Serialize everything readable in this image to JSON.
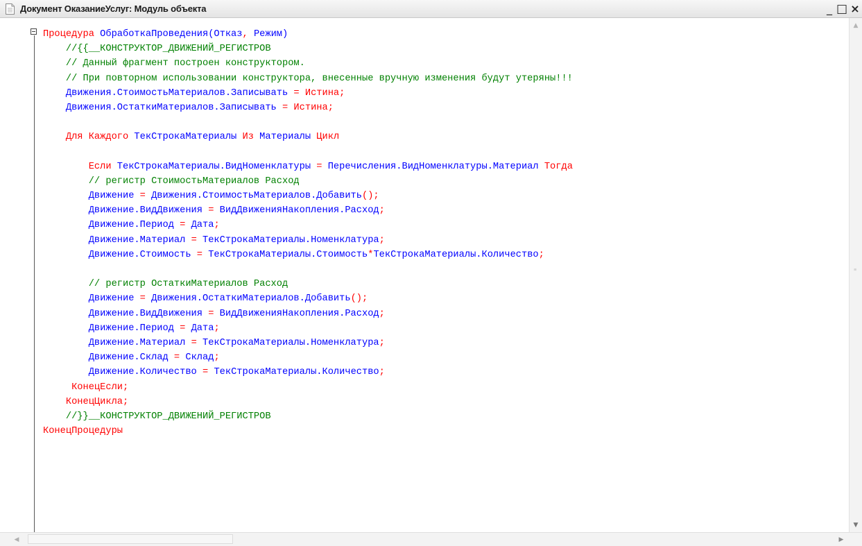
{
  "window": {
    "title": "Документ ОказаниеУслуг: Модуль объекта",
    "minimize_label": "_",
    "maximize_label": "□",
    "close_label": "×"
  },
  "colors": {
    "keyword": "#ff0000",
    "identifier": "#0000ff",
    "comment": "#008000"
  },
  "code": {
    "lines": [
      [
        [
          "kw",
          "Процедура "
        ],
        [
          "id",
          "ОбработкаПроведения(Отказ"
        ],
        [
          "op",
          ", "
        ],
        [
          "id",
          "Режим)"
        ]
      ],
      [
        [
          "cm",
          "    //{{__КОНСТРУКТОР_ДВИЖЕНИЙ_РЕГИСТРОВ"
        ]
      ],
      [
        [
          "cm",
          "    // Данный фрагмент построен конструктором."
        ]
      ],
      [
        [
          "cm",
          "    // При повторном использовании конструктора, внесенные вручную изменения будут утеряны!!!"
        ]
      ],
      [
        [
          "id",
          "    Движения.СтоимостьМатериалов.Записывать "
        ],
        [
          "op",
          "= "
        ],
        [
          "kw",
          "Истина"
        ],
        [
          "op",
          ";"
        ]
      ],
      [
        [
          "id",
          "    Движения.ОстаткиМатериалов.Записывать "
        ],
        [
          "op",
          "= "
        ],
        [
          "kw",
          "Истина"
        ],
        [
          "op",
          ";"
        ]
      ],
      [],
      [
        [
          "kw",
          "    Для Каждого "
        ],
        [
          "id",
          "ТекСтрокаМатериалы "
        ],
        [
          "kw",
          "Из "
        ],
        [
          "id",
          "Материалы "
        ],
        [
          "kw",
          "Цикл"
        ]
      ],
      [],
      [
        [
          "kw",
          "        Если "
        ],
        [
          "id",
          "ТекСтрокаМатериалы.ВидНоменклатуры "
        ],
        [
          "op",
          "= "
        ],
        [
          "id",
          "Перечисления.ВидНоменклатуры.Материал "
        ],
        [
          "kw",
          "Тогда"
        ]
      ],
      [
        [
          "cm",
          "        // регистр СтоимостьМатериалов Расход"
        ]
      ],
      [
        [
          "id",
          "        Движение "
        ],
        [
          "op",
          "= "
        ],
        [
          "id",
          "Движения.СтоимостьМатериалов.Добавить"
        ],
        [
          "op",
          "();"
        ]
      ],
      [
        [
          "id",
          "        Движение.ВидДвижения "
        ],
        [
          "op",
          "= "
        ],
        [
          "id",
          "ВидДвиженияНакопления.Расход"
        ],
        [
          "op",
          ";"
        ]
      ],
      [
        [
          "id",
          "        Движение.Период "
        ],
        [
          "op",
          "= "
        ],
        [
          "id",
          "Дата"
        ],
        [
          "op",
          ";"
        ]
      ],
      [
        [
          "id",
          "        Движение.Материал "
        ],
        [
          "op",
          "= "
        ],
        [
          "id",
          "ТекСтрокаМатериалы.Номенклатура"
        ],
        [
          "op",
          ";"
        ]
      ],
      [
        [
          "id",
          "        Движение.Стоимость "
        ],
        [
          "op",
          "= "
        ],
        [
          "id",
          "ТекСтрокаМатериалы.Стоимость"
        ],
        [
          "op",
          "*"
        ],
        [
          "id",
          "ТекСтрокаМатериалы.Количество"
        ],
        [
          "op",
          ";"
        ]
      ],
      [],
      [
        [
          "cm",
          "        // регистр ОстаткиМатериалов Расход"
        ]
      ],
      [
        [
          "id",
          "        Движение "
        ],
        [
          "op",
          "= "
        ],
        [
          "id",
          "Движения.ОстаткиМатериалов.Добавить"
        ],
        [
          "op",
          "();"
        ]
      ],
      [
        [
          "id",
          "        Движение.ВидДвижения "
        ],
        [
          "op",
          "= "
        ],
        [
          "id",
          "ВидДвиженияНакопления.Расход"
        ],
        [
          "op",
          ";"
        ]
      ],
      [
        [
          "id",
          "        Движение.Период "
        ],
        [
          "op",
          "= "
        ],
        [
          "id",
          "Дата"
        ],
        [
          "op",
          ";"
        ]
      ],
      [
        [
          "id",
          "        Движение.Материал "
        ],
        [
          "op",
          "= "
        ],
        [
          "id",
          "ТекСтрокаМатериалы.Номенклатура"
        ],
        [
          "op",
          ";"
        ]
      ],
      [
        [
          "id",
          "        Движение.Склад "
        ],
        [
          "op",
          "= "
        ],
        [
          "id",
          "Склад"
        ],
        [
          "op",
          ";"
        ]
      ],
      [
        [
          "id",
          "        Движение.Количество "
        ],
        [
          "op",
          "= "
        ],
        [
          "id",
          "ТекСтрокаМатериалы.Количество"
        ],
        [
          "op",
          ";"
        ]
      ],
      [
        [
          "kw",
          "     КонецЕсли"
        ],
        [
          "op",
          ";"
        ]
      ],
      [
        [
          "kw",
          "    КонецЦикла"
        ],
        [
          "op",
          ";"
        ]
      ],
      [
        [
          "cm",
          "    //}}__КОНСТРУКТОР_ДВИЖЕНИЙ_РЕГИСТРОВ"
        ]
      ],
      [
        [
          "kw",
          "КонецПроцедуры"
        ]
      ]
    ]
  }
}
